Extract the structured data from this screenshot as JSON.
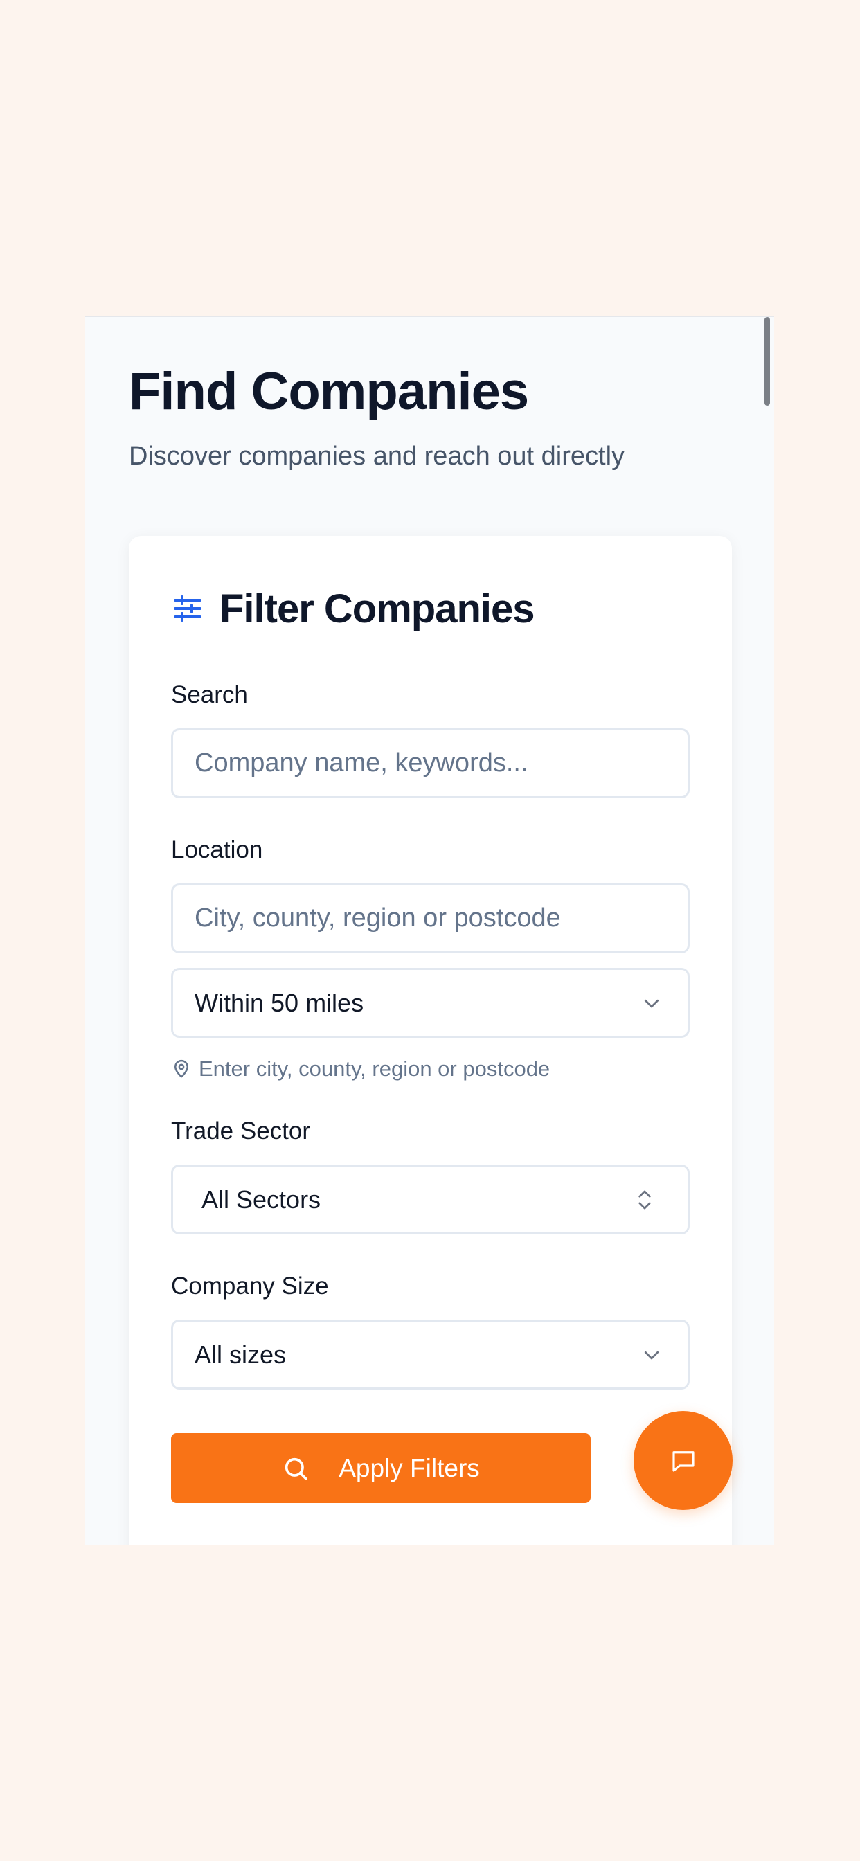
{
  "page": {
    "title": "Find Companies",
    "subtitle": "Discover companies and reach out directly"
  },
  "filter_card": {
    "title": "Filter Companies",
    "icon": "sliders-icon",
    "search": {
      "label": "Search",
      "value": "",
      "placeholder": "Company name, keywords..."
    },
    "location": {
      "label": "Location",
      "value": "",
      "placeholder": "City, county, region or postcode",
      "radius_selected": "Within 50 miles",
      "helper": "Enter city, county, region or postcode",
      "helper_icon": "map-pin-icon"
    },
    "trade_sector": {
      "label": "Trade Sector",
      "selected": "All Sectors"
    },
    "company_size": {
      "label": "Company Size",
      "selected": "All sizes"
    },
    "apply_button": {
      "label": "Apply Filters",
      "icon": "search-icon"
    }
  },
  "chat_fab": {
    "icon": "chat-bubble-icon"
  },
  "colors": {
    "accent": "#f97316",
    "icon_blue": "#2563eb",
    "title": "#0f172a",
    "muted": "#64748b",
    "page_bg": "#fdf4ee",
    "app_bg": "#f8fafc"
  }
}
